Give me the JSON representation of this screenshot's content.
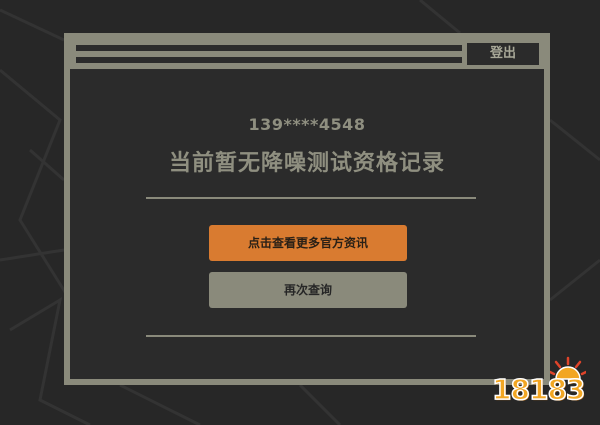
{
  "window": {
    "logout_label": "登出"
  },
  "content": {
    "phone_masked": "139****4548",
    "headline": "当前暂无降噪测试资格记录"
  },
  "actions": {
    "more_info_label": "点击查看更多官方资讯",
    "query_again_label": "再次查询"
  },
  "watermark": {
    "text": "18183"
  },
  "colors": {
    "background": "#272727",
    "frame": "#8a8a7b",
    "text_muted": "#8f8f80",
    "accent_orange": "#d97b30",
    "watermark_orange": "#f2a623"
  }
}
